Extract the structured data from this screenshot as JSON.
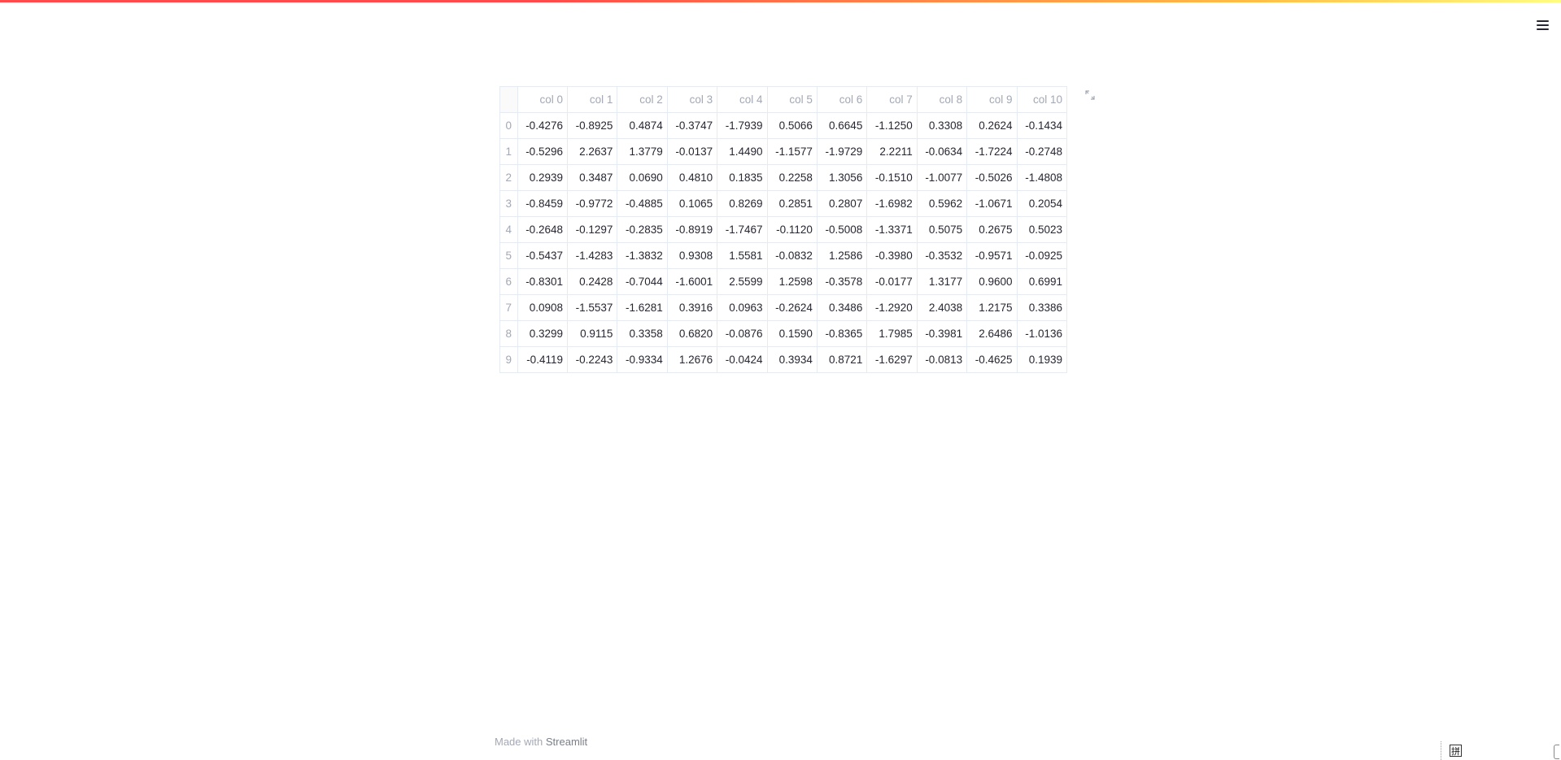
{
  "header": {
    "accent_gradient": [
      "#ff4b4b",
      "#ffbd45",
      "#fffd80"
    ],
    "menu_icon": "hamburger-menu-icon"
  },
  "dataframe": {
    "columns": [
      "col 0",
      "col 1",
      "col 2",
      "col 3",
      "col 4",
      "col 5",
      "col 6",
      "col 7",
      "col 8",
      "col 9",
      "col 10"
    ],
    "rows": [
      {
        "index": "0",
        "cells": [
          "-0.4276",
          "-0.8925",
          "0.4874",
          "-0.3747",
          "-1.7939",
          "0.5066",
          "0.6645",
          "-1.1250",
          "0.3308",
          "0.2624",
          "-0.1434"
        ]
      },
      {
        "index": "1",
        "cells": [
          "-0.5296",
          "2.2637",
          "1.3779",
          "-0.0137",
          "1.4490",
          "-1.1577",
          "-1.9729",
          "2.2211",
          "-0.0634",
          "-1.7224",
          "-0.2748"
        ]
      },
      {
        "index": "2",
        "cells": [
          "0.2939",
          "0.3487",
          "0.0690",
          "0.4810",
          "0.1835",
          "0.2258",
          "1.3056",
          "-0.1510",
          "-1.0077",
          "-0.5026",
          "-1.4808"
        ]
      },
      {
        "index": "3",
        "cells": [
          "-0.8459",
          "-0.9772",
          "-0.4885",
          "0.1065",
          "0.8269",
          "0.2851",
          "0.2807",
          "-1.6982",
          "0.5962",
          "-1.0671",
          "0.2054"
        ]
      },
      {
        "index": "4",
        "cells": [
          "-0.2648",
          "-0.1297",
          "-0.2835",
          "-0.8919",
          "-1.7467",
          "-0.1120",
          "-0.5008",
          "-1.3371",
          "0.5075",
          "0.2675",
          "0.5023"
        ]
      },
      {
        "index": "5",
        "cells": [
          "-0.5437",
          "-1.4283",
          "-1.3832",
          "0.9308",
          "1.5581",
          "-0.0832",
          "1.2586",
          "-0.3980",
          "-0.3532",
          "-0.9571",
          "-0.0925"
        ]
      },
      {
        "index": "6",
        "cells": [
          "-0.8301",
          "0.2428",
          "-0.7044",
          "-1.6001",
          "2.5599",
          "1.2598",
          "-0.3578",
          "-0.0177",
          "1.3177",
          "0.9600",
          "0.6991"
        ]
      },
      {
        "index": "7",
        "cells": [
          "0.0908",
          "-1.5537",
          "-1.6281",
          "0.3916",
          "0.0963",
          "-0.2624",
          "0.3486",
          "-1.2920",
          "2.4038",
          "1.2175",
          "0.3386"
        ]
      },
      {
        "index": "8",
        "cells": [
          "0.3299",
          "0.9115",
          "0.3358",
          "0.6820",
          "-0.0876",
          "0.1590",
          "-0.8365",
          "1.7985",
          "-0.3981",
          "2.6486",
          "-1.0136"
        ]
      },
      {
        "index": "9",
        "cells": [
          "-0.4119",
          "-0.2243",
          "-0.9334",
          "1.2676",
          "-0.0424",
          "0.3934",
          "0.8721",
          "-1.6297",
          "-0.0813",
          "-0.4625",
          "0.1939"
        ]
      }
    ],
    "expand_icon": "fullscreen-expand-icon"
  },
  "footer": {
    "prefix": "Made with",
    "brand": "Streamlit"
  },
  "taskbar": {
    "ime_label": "拼"
  }
}
